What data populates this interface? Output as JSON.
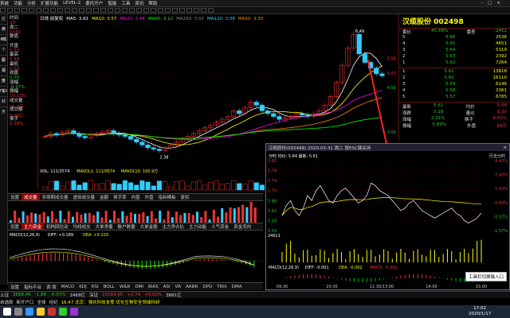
{
  "menubar": {
    "items": [
      "系统",
      "功能",
      "分析",
      "扩展功能",
      "LEVEL-2",
      "委托开户",
      "智能",
      "工具",
      "资讯",
      "帮助"
    ],
    "window_controls": [
      "–",
      "□",
      "×"
    ]
  },
  "leftrail": {
    "items": [
      "应用",
      "分时",
      "K线",
      "个股",
      "资讯",
      "深度",
      "分析",
      "F10",
      "财务"
    ]
  },
  "infocol": {
    "items": [
      {
        "label": "时间",
        "value": "20",
        "green": false
      },
      {
        "label": "周二",
        "value": "0331",
        "green": false
      },
      {
        "label": "数值",
        "value": "",
        "green": false
      },
      {
        "label": "开盘",
        "value": "5.53",
        "green": false
      },
      {
        "label": "最高",
        "value": "5.59",
        "green": false
      },
      {
        "label": "最低",
        "value": "5.03",
        "green": false
      },
      {
        "label": "收盘",
        "value": "5.03",
        "green": true
      },
      {
        "label": "涨幅",
        "value": "-8.97%",
        "green": true
      },
      {
        "label": "振幅",
        "value": "10.13%",
        "green": false
      },
      {
        "label": "成交量",
        "value": "96.3万",
        "green": false
      },
      {
        "label": "成交额",
        "value": "5.05亿",
        "green": false
      },
      {
        "label": "换手",
        "value": "3.28%",
        "green": false
      }
    ]
  },
  "chart": {
    "ma_legend": [
      "日线 前复权",
      "MA5: 3.81",
      "MA10: 3.57",
      "MA20: 3.44",
      "MA60: 3.12",
      "MA250: 3.02",
      "MA120: 3.08",
      "MA30: 3.30"
    ],
    "high_label": "6.49",
    "low_label": "2.38",
    "vol_legend": [
      "VOL: 111/3574",
      "MAVOL1: 111/0574",
      "MAVOL10: 165.9万"
    ],
    "macd_legend": [
      "MACD(12,26,9)",
      "DIFF: +0.189",
      "DEA: +0.220"
    ],
    "ref_prices": [
      "5.58",
      "5.07",
      "4.56",
      "3.00"
    ],
    "candles": [
      2.9,
      3.0,
      2.95,
      3.05,
      3.1,
      3.0,
      2.9,
      2.85,
      2.95,
      3.0,
      3.05,
      3.1,
      3.0,
      2.95,
      2.9,
      2.8,
      2.7,
      2.6,
      2.5,
      2.45,
      2.4,
      2.5,
      2.6,
      2.7,
      2.8,
      2.9,
      3.0,
      3.1,
      3.2,
      3.3,
      3.4,
      3.5,
      3.6,
      3.8,
      3.7,
      3.9,
      4.1,
      4.0,
      3.8,
      3.7,
      3.6,
      3.5,
      3.55,
      3.6,
      3.7,
      3.65,
      3.6,
      3.7,
      3.8,
      4.0,
      4.3,
      4.8,
      5.4,
      6.0,
      6.49,
      5.8,
      5.5,
      5.3,
      5.1,
      5.03
    ]
  },
  "quote": {
    "title": "汉缆股份 002498",
    "header": [
      "委比",
      "-45.68%",
      "委差",
      "-2452"
    ],
    "asks": [
      {
        "label": "5",
        "price": "5.66",
        "vol": "2536"
      },
      {
        "label": "4",
        "price": "5.65",
        "vol": "4651"
      },
      {
        "label": "3",
        "price": "5.64",
        "vol": "5319"
      },
      {
        "label": "2",
        "price": "5.63",
        "vol": "2392"
      },
      {
        "label": "1",
        "price": "5.62",
        "vol": "7264"
      }
    ],
    "bids": [
      {
        "label": "1",
        "price": "5.61",
        "vol": "13818"
      },
      {
        "label": "2",
        "price": "5.60",
        "vol": "16110"
      },
      {
        "label": "3",
        "price": "5.59",
        "vol": "6146"
      },
      {
        "label": "4",
        "price": "5.58",
        "vol": "3361"
      },
      {
        "label": "5",
        "price": "5.57",
        "vol": "6785"
      }
    ],
    "stats": [
      {
        "k": "最新",
        "v": "5.61",
        "k2": "均价",
        "v2": "5.64"
      },
      {
        "k": "涨跌",
        "v": "0.18",
        "k2": "量比",
        "v2": "1.30"
      },
      {
        "k": "涨幅",
        "v": "3.31%",
        "k2": "换手",
        "v2": "4.01%"
      },
      {
        "k": "振幅",
        "v": "5.89%",
        "k2": "外盘",
        "v2": "89万"
      }
    ]
  },
  "subtabs": [
    "设置",
    "成交量",
    "多周期成交量",
    "虚拟成交量",
    "金额",
    "换手率",
    "内盘",
    "外盘",
    "指标模板",
    "复权"
  ],
  "subtabs_active": 1,
  "subtabs2": [
    "设置",
    "主力资金",
    "机构回拉动",
    "均线成交",
    "大单净量",
    "散户数量",
    "大单金额",
    "主力净占比",
    "主力动能",
    "人气资金",
    "资金流向"
  ],
  "subtabs2_active": 1,
  "bottomtabs": [
    "设置",
    "指标平台",
    "调 拨",
    "MACD",
    "KDJ",
    "RSI",
    "BOLL",
    "W&R",
    "DMI",
    "BIAS",
    "ASI",
    "VR",
    "ARBR",
    "DPO",
    "TRIX",
    "DMA"
  ],
  "statusbar": [
    {
      "t": "上证",
      "c": "w"
    },
    {
      "t": "2668.46",
      "c": "g"
    },
    {
      "t": "-1.88",
      "c": "g"
    },
    {
      "t": "-0.07%",
      "c": "g"
    },
    {
      "t": "2469亿",
      "c": "w"
    },
    {
      "t": "深证",
      "c": "w"
    },
    {
      "t": "10264.65",
      "c": "r"
    },
    {
      "t": "+2.74",
      "c": "r"
    },
    {
      "t": "+0.02%",
      "c": "r"
    },
    {
      "t": "3881亿",
      "c": "w"
    }
  ],
  "newsbar": [
    {
      "t": "自选股",
      "c": "w"
    },
    {
      "t": "新开户口",
      "c": "w"
    },
    {
      "t": "全球",
      "c": "w"
    },
    {
      "t": "经纪",
      "c": "w"
    },
    {
      "t": "16:47 北京：强化科技支撑 优化生物安全领域科研",
      "c": "y"
    }
  ],
  "popup": {
    "title": "汉缆股份(002498)  2020-03-31 周二   按ESC键关闭",
    "info": "分时  均价: 5.64  最新: 5.61",
    "tabs_top": [
      "历史分时"
    ],
    "left_prices": [
      "5.82",
      "5.78",
      "5.74",
      "5.70",
      "5.66",
      "5.62",
      "5.58",
      "5.54"
    ],
    "right_pcts": [
      "4.43%",
      "2.43%",
      "1.43%",
      "0.43%",
      "-0.57%",
      "-1.57%"
    ],
    "macd": [
      "MACD(12,26,9)",
      "DIFF: -0.001",
      "DEA: -0.002",
      "MACD: -0.002"
    ],
    "times": [
      "09:30",
      "10:30",
      "11:30/13:00",
      "14:00",
      "15:00"
    ],
    "vol_label": "24611",
    "line": [
      5.6,
      5.64,
      5.66,
      5.62,
      5.6,
      5.63,
      5.68,
      5.66,
      5.7,
      5.72,
      5.69,
      5.66,
      5.65,
      5.68,
      5.7,
      5.71,
      5.69,
      5.67,
      5.65,
      5.66,
      5.68,
      5.73,
      5.72,
      5.7,
      5.69,
      5.68,
      5.66,
      5.64,
      5.62,
      5.63,
      5.65,
      5.66,
      5.64,
      5.62,
      5.61,
      5.6,
      5.59,
      5.6,
      5.61,
      5.62,
      5.63,
      5.61,
      5.6,
      5.58,
      5.57,
      5.58,
      5.59,
      5.61
    ]
  },
  "popuptabs": [
    "MACDFS",
    "KDJ",
    "RSI",
    "BOLL"
  ],
  "popuptabs_active": 0,
  "ime": "工具栏切换输入口",
  "clock": {
    "time": "17:02",
    "date": "2020/1/17"
  }
}
